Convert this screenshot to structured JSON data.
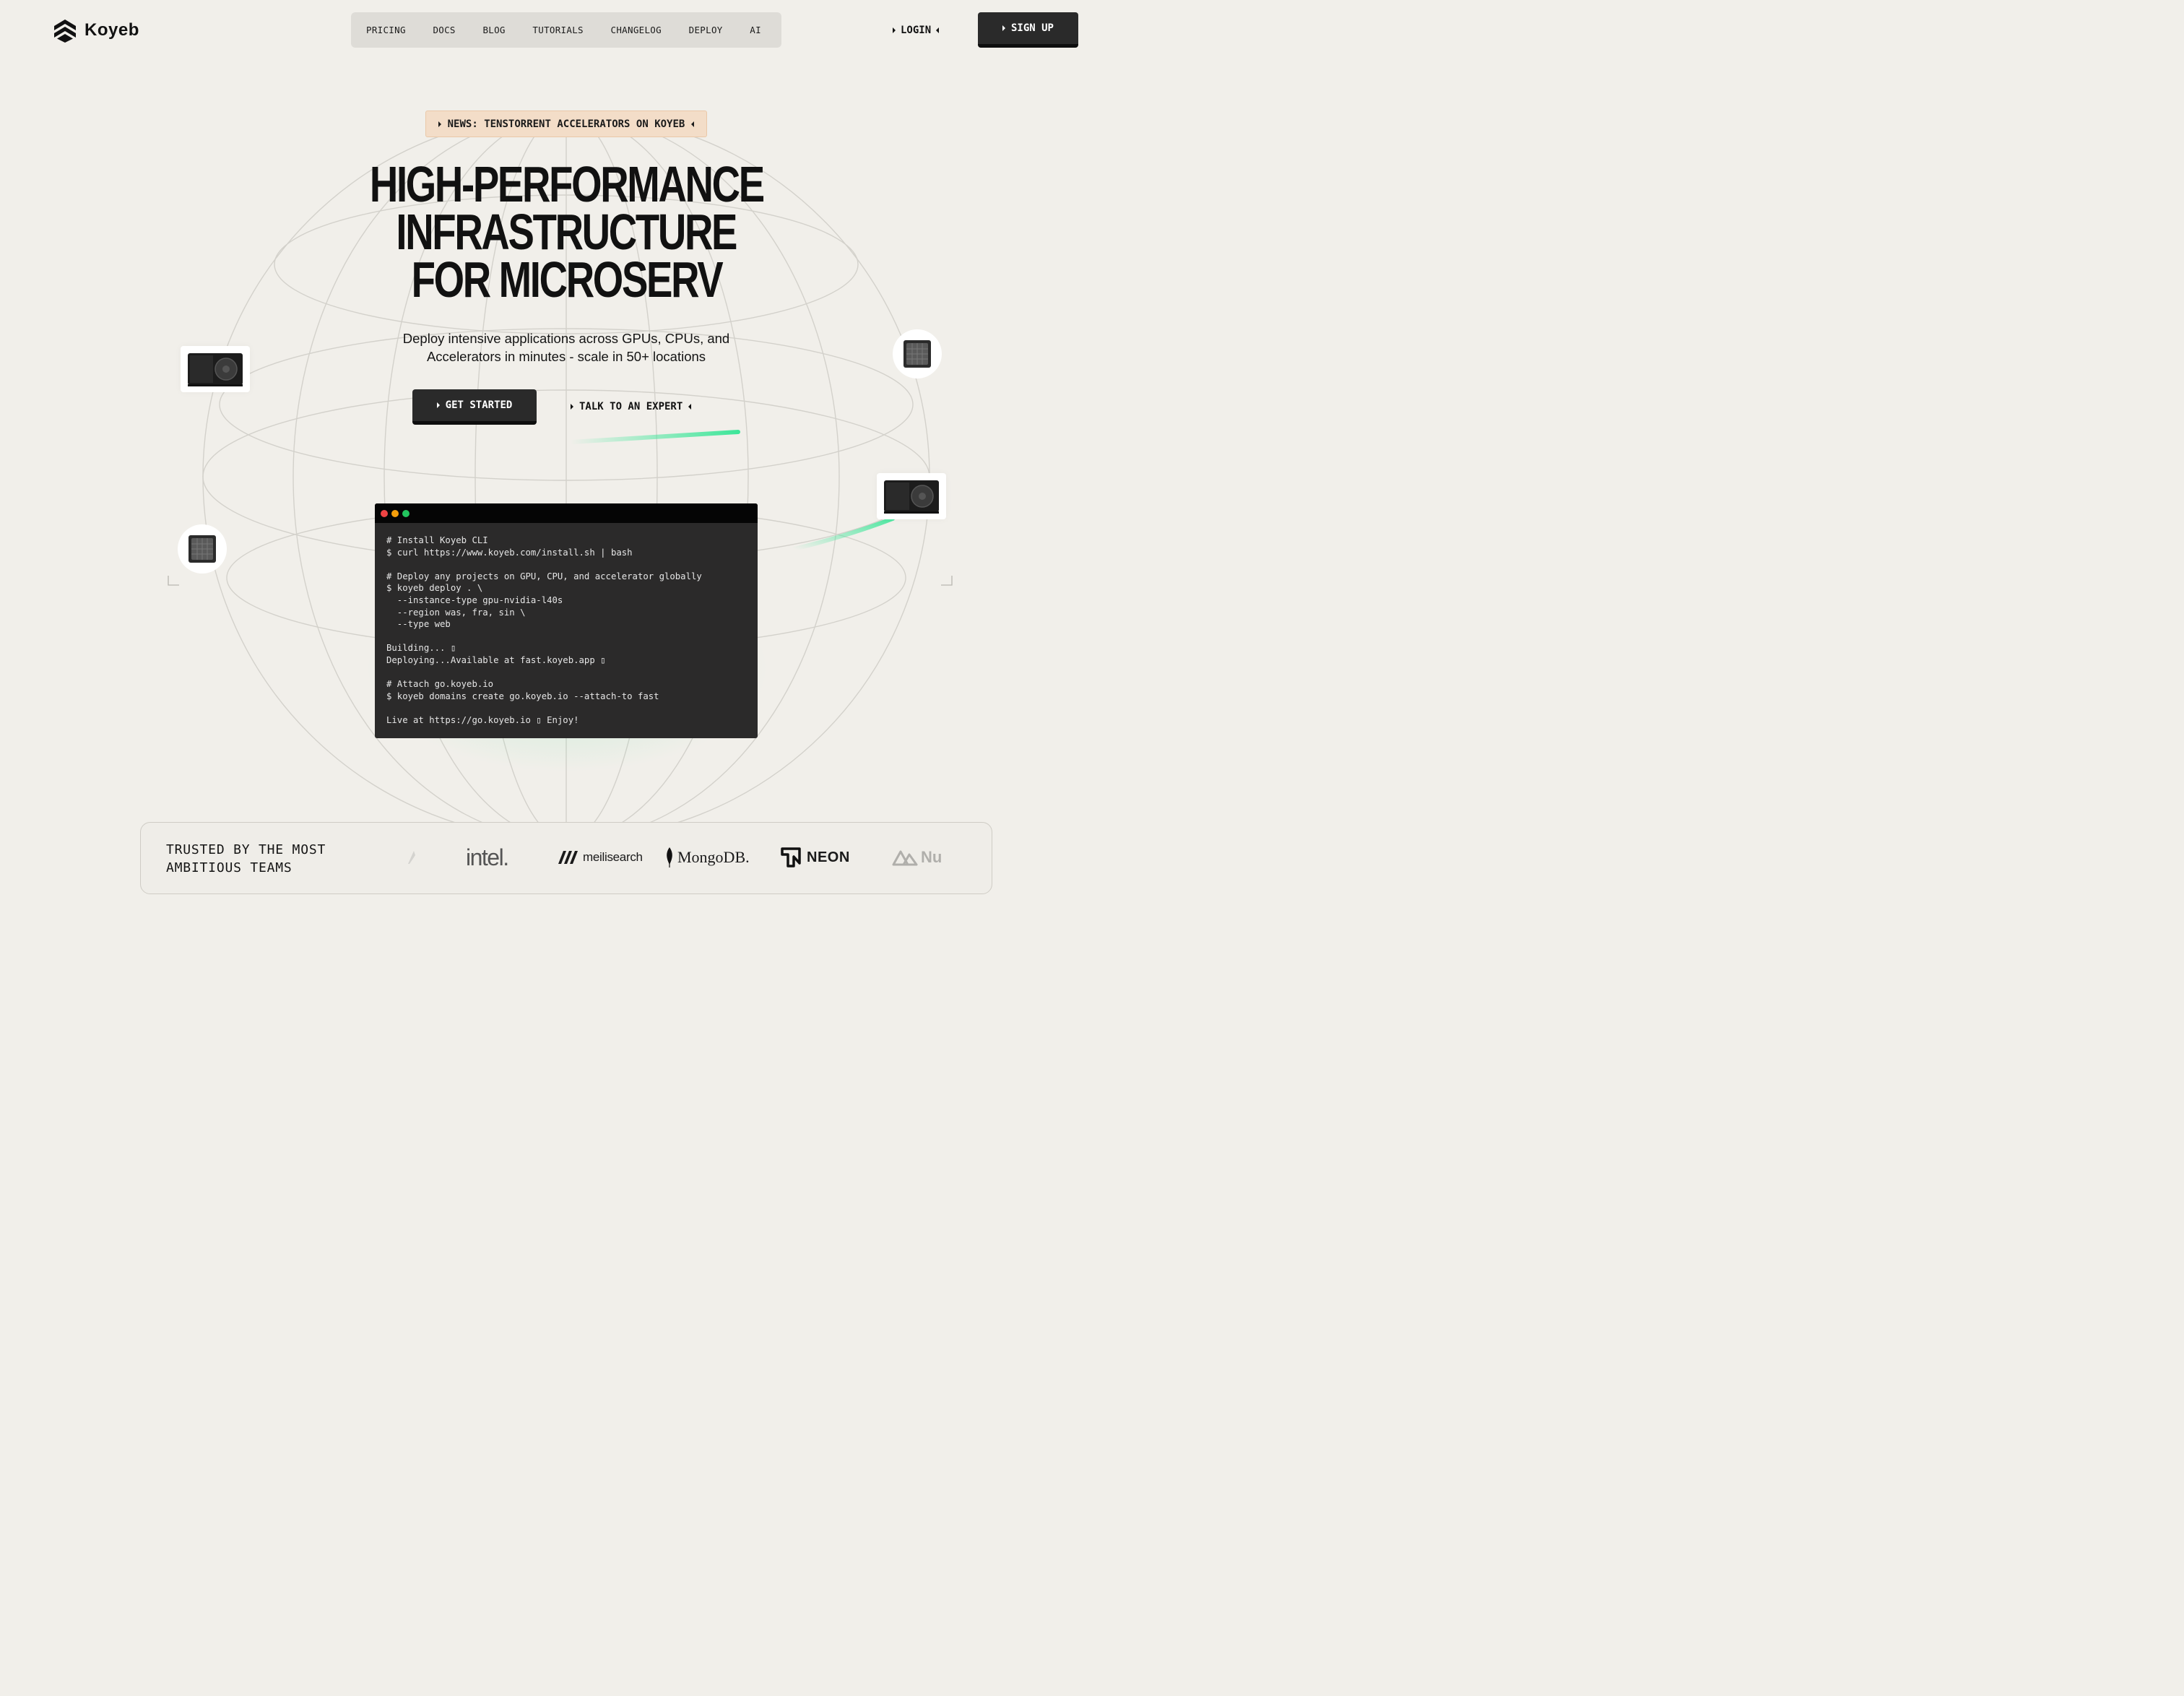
{
  "brand": {
    "name": "Koyeb"
  },
  "nav": {
    "items": [
      {
        "label": "PRICING"
      },
      {
        "label": "DOCS"
      },
      {
        "label": "BLOG"
      },
      {
        "label": "TUTORIALS"
      },
      {
        "label": "CHANGELOG"
      },
      {
        "label": "DEPLOY"
      },
      {
        "label": "AI"
      }
    ],
    "login_label": "LOGIN",
    "signup_label": "SIGN UP"
  },
  "hero": {
    "news_label": "NEWS: TENSTORRENT ACCELERATORS ON KOYEB",
    "title_lines": [
      "HIGH-PERFORMANCE",
      "INFRASTRUCTURE",
      "FOR MICROSERV"
    ],
    "subtitle_lines": [
      "Deploy intensive applications across GPUs, CPUs, and",
      "Accelerators in minutes - scale in 50+ locations"
    ],
    "cta_primary": "GET STARTED",
    "cta_secondary": "TALK TO AN EXPERT"
  },
  "terminal": {
    "lines": [
      "# Install Koyeb CLI",
      "$ curl https://www.koyeb.com/install.sh | bash",
      "",
      "# Deploy any projects on GPU, CPU, and accelerator globally",
      "$ koyeb deploy . \\",
      "  --instance-type gpu-nvidia-l40s",
      "  --region was, fra, sin \\",
      "  --type web",
      "",
      "Building... ▯",
      "Deploying...Available at fast.koyeb.app ▯",
      "",
      "# Attach go.koyeb.io",
      "$ koyeb domains create go.koyeb.io --attach-to fast",
      "",
      "Live at https://go.koyeb.io ▯ Enjoy!"
    ]
  },
  "trusted": {
    "label_lines": [
      "TRUSTED BY THE MOST",
      "AMBITIOUS TEAMS"
    ],
    "logos": [
      {
        "name": "intel",
        "text": "intel."
      },
      {
        "name": "meilisearch",
        "text": "meilisearch"
      },
      {
        "name": "mongodb",
        "text": "MongoDB."
      },
      {
        "name": "neon",
        "text": "NEON"
      },
      {
        "name": "nuxt",
        "text": "Nu"
      }
    ]
  },
  "colors": {
    "background": "#f1efea",
    "dark_button": "#2a2a2a",
    "news_bg": "#f3ddc8",
    "accent_green": "#3ee69a",
    "terminal_bg": "#2b2a2a",
    "dot_red": "#ef4444",
    "dot_yellow": "#f59e0b",
    "dot_green": "#22c55e"
  }
}
